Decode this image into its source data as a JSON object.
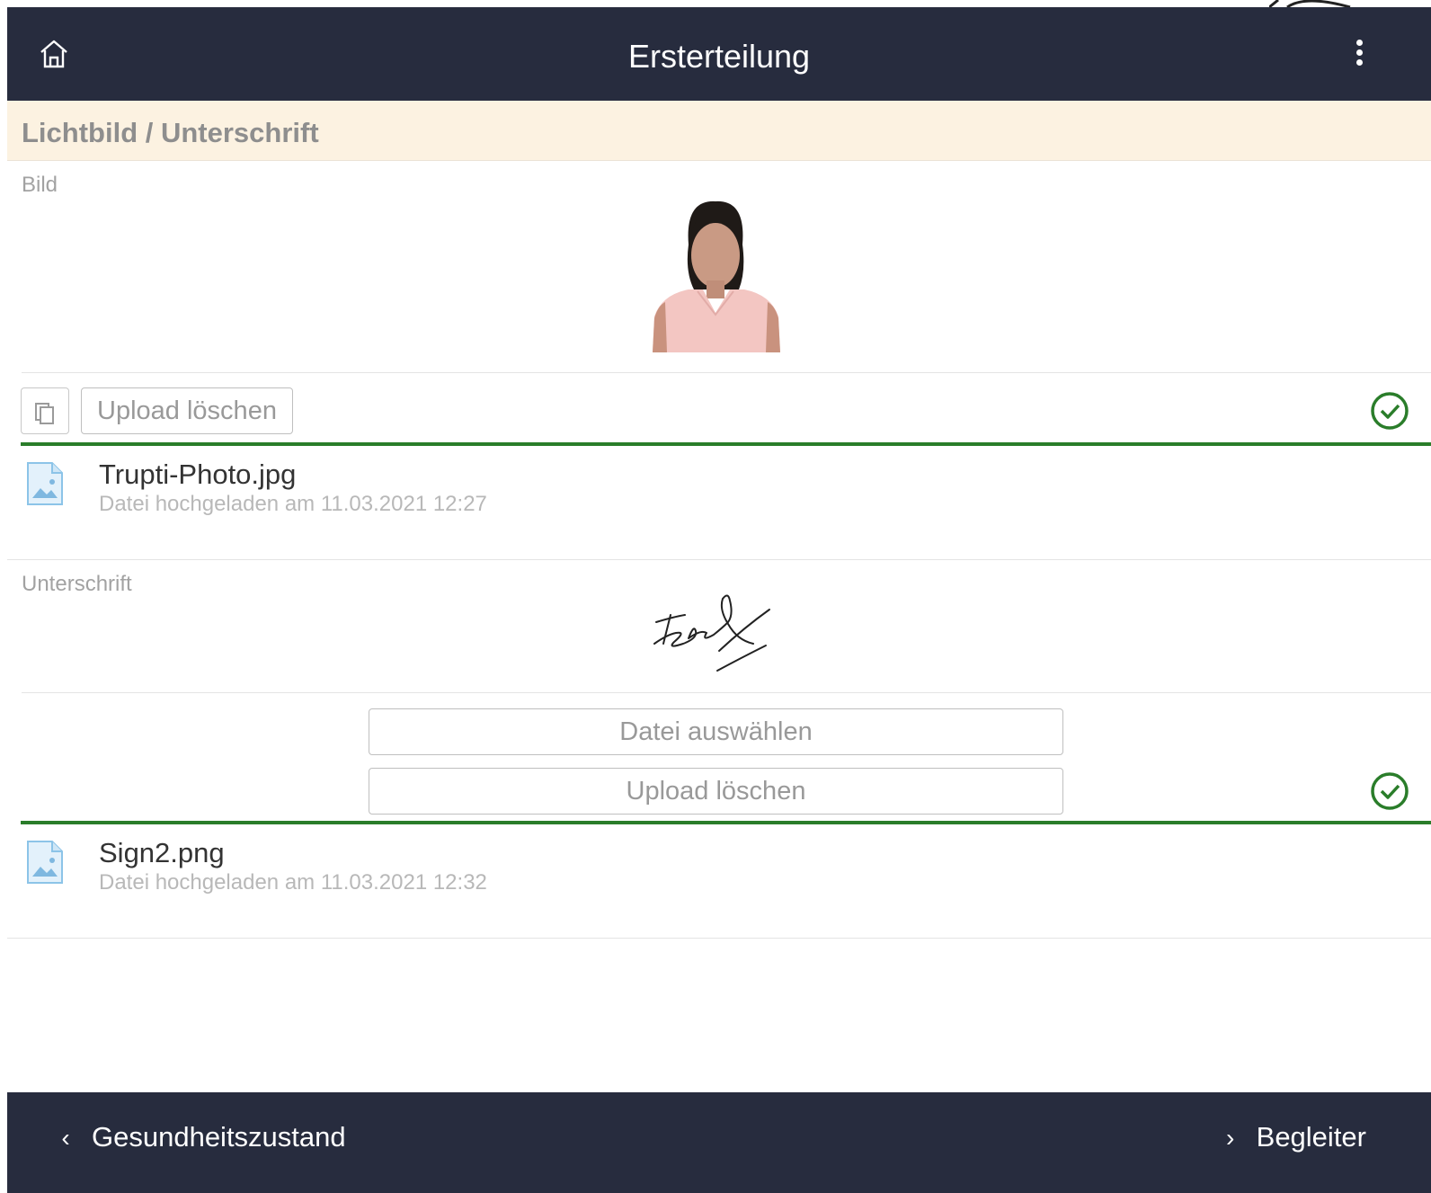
{
  "header": {
    "title": "Ersterteilung",
    "icons": {
      "home": "home-icon",
      "menu": "more-vertical-icon"
    }
  },
  "section": {
    "title": "Lichtbild / Unterschrift"
  },
  "photo": {
    "label": "Bild",
    "buttons": {
      "copy_icon": "copy-icon",
      "delete_label": "Upload löschen"
    },
    "status_icon": "check-circle-icon",
    "file": {
      "name": "Trupti-Photo.jpg",
      "meta": "Datei hochgeladen am 11.03.2021 12:27",
      "icon": "image-file-icon"
    }
  },
  "signature": {
    "label": "Unterschrift",
    "buttons": {
      "choose_label": "Datei auswählen",
      "delete_label": "Upload löschen"
    },
    "status_icon": "check-circle-icon",
    "file": {
      "name": "Sign2.png",
      "meta": "Datei hochgeladen am 11.03.2021 12:32",
      "icon": "image-file-icon"
    }
  },
  "footer": {
    "back_label": "Gesundheitszustand",
    "next_label": "Begleiter"
  },
  "colors": {
    "topbar": "#272c3e",
    "section_bg": "#fcf2e1",
    "success": "#2a7d2a"
  }
}
